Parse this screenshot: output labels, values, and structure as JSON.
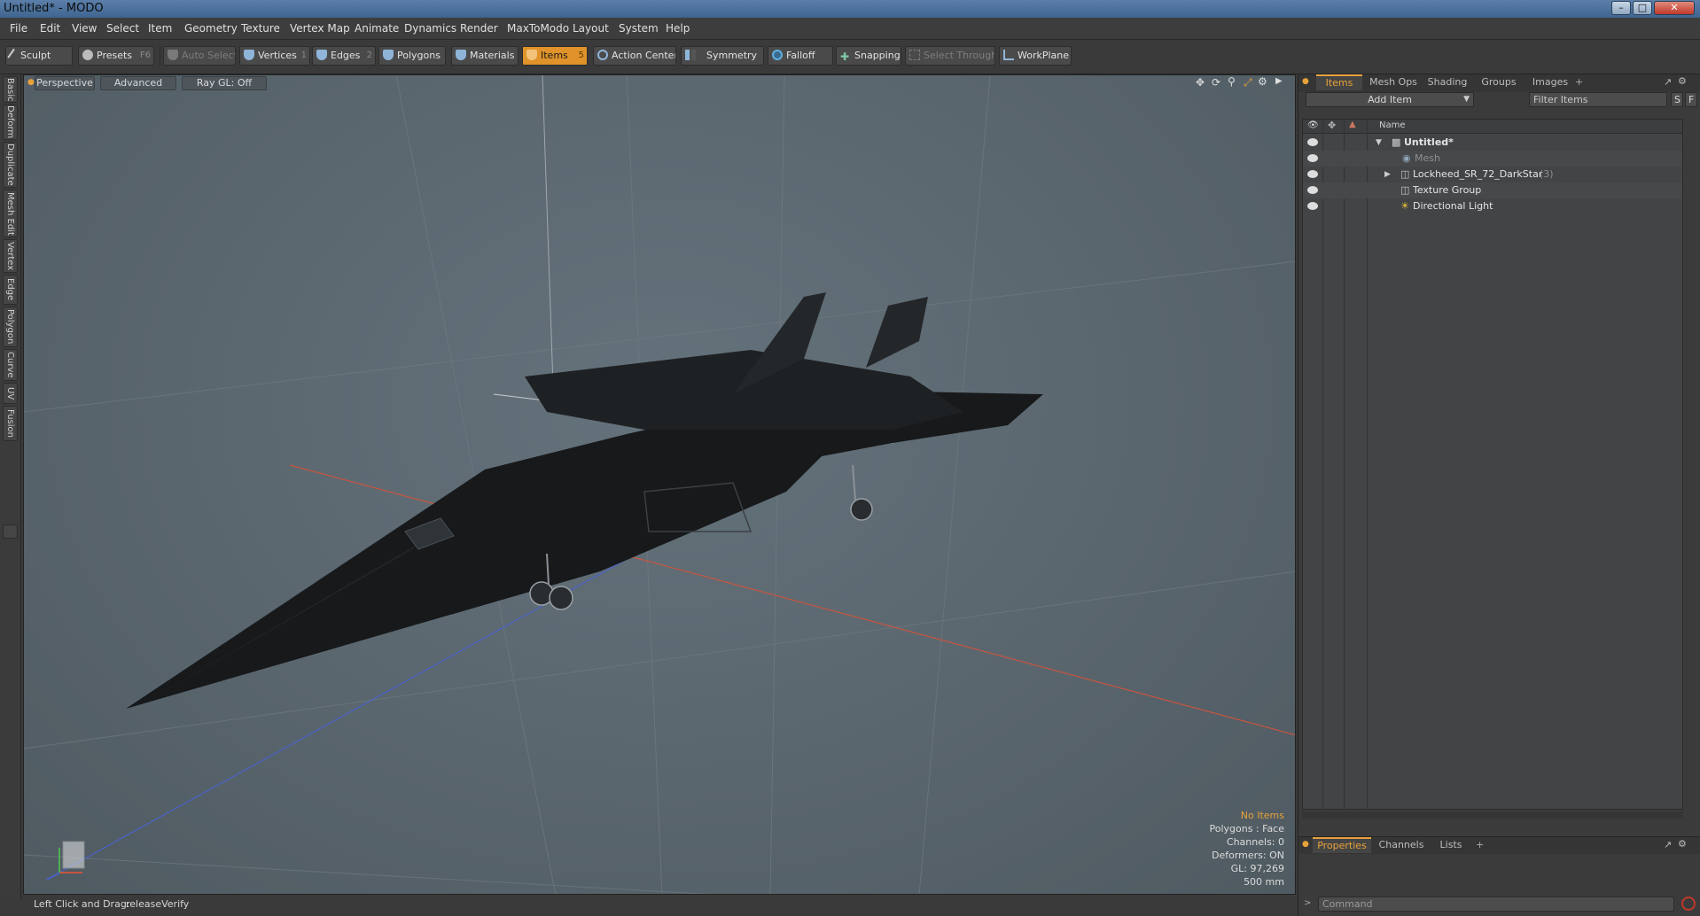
{
  "window": {
    "title": "Untitled* - MODO",
    "min": "–",
    "max": "□",
    "close": "✕"
  },
  "menu": [
    "File",
    "Edit",
    "View",
    "Select",
    "Item",
    "Geometry",
    "Texture",
    "Vertex Map",
    "Animate",
    "Dynamics",
    "Render",
    "MaxToModo",
    "Layout",
    "System",
    "Help"
  ],
  "toolbar": {
    "sculpt": "Sculpt",
    "presets": "Presets",
    "presets_key": "F6",
    "auto_select": "Auto Select",
    "vertices": "Vertices",
    "vertices_key": "1",
    "edges": "Edges",
    "edges_key": "2",
    "polygons": "Polygons",
    "materials": "Materials",
    "items": "Items",
    "items_key": "5",
    "action_center": "Action Center",
    "symmetry": "Symmetry",
    "falloff": "Falloff",
    "snapping": "Snapping",
    "select_through": "Select Through",
    "workplane": "WorkPlane"
  },
  "left_tabs": [
    "Basic",
    "Deform",
    "Duplicate",
    "Mesh Edit",
    "Vertex",
    "Edge",
    "Polygon",
    "Curve",
    "UV",
    "Fusion"
  ],
  "viewport": {
    "view": "Perspective",
    "mode": "Advanced",
    "raygl": "Ray GL: Off",
    "stats": {
      "items": "No Items",
      "polygons": "Polygons : Face",
      "channels": "Channels: 0",
      "deformers": "Deformers: ON",
      "gl": "GL: 97,269",
      "scale": "500 mm"
    }
  },
  "status": {
    "hint": "Left Click and Drag:",
    "action": "releaseVerify"
  },
  "panel": {
    "tabs": [
      "Items",
      "Mesh Ops",
      "Shading",
      "Groups",
      "Images"
    ],
    "add_item": "Add Item",
    "filter_placeholder": "Filter Items",
    "s_btn": "S",
    "f_btn": "F",
    "col_name": "Name",
    "tree": [
      {
        "label": "Untitled*",
        "count": ""
      },
      {
        "label": "Mesh",
        "count": ""
      },
      {
        "label": "Lockheed_SR_72_DarkStar",
        "count": "(3)"
      },
      {
        "label": "Texture Group",
        "count": ""
      },
      {
        "label": "Directional Light",
        "count": ""
      }
    ],
    "bottom_tabs": [
      "Properties",
      "Channels",
      "Lists"
    ],
    "command_placeholder": "Command"
  },
  "colors": {
    "accent": "#e8a23a",
    "viewport": "#5e6a72",
    "axis_x": "#c8553f",
    "axis_z": "#4a63c8"
  }
}
